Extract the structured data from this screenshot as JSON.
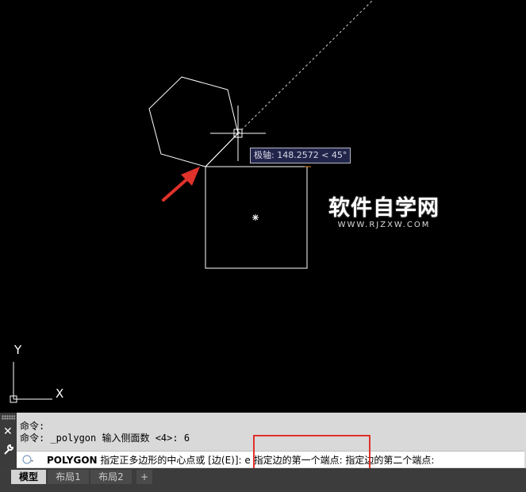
{
  "viewport": {
    "tooltip": "极轴: 148.2572 < 45°",
    "ucs_axis_y": "Y",
    "ucs_axis_x": "X",
    "watermark_title": "软件自学网",
    "watermark_url": "WWW.RJZXW.COM"
  },
  "command_window": {
    "history": [
      "命令:",
      "命令: _polygon 输入侧面数 <4>: 6"
    ],
    "current_command": "POLYGON",
    "current_prompt": "指定正多边形的中心点或 [边(E)]: e 指定边的第一个端点: 指定边的第二个端点:"
  },
  "tabs": [
    "模型",
    "布局1",
    "布局2",
    "+"
  ],
  "colors": {
    "background": "#000000",
    "entity": "#ffffff",
    "arrow": "#e0312b",
    "highlight": "#e0312b",
    "tooltip_bg": "#22254a"
  }
}
